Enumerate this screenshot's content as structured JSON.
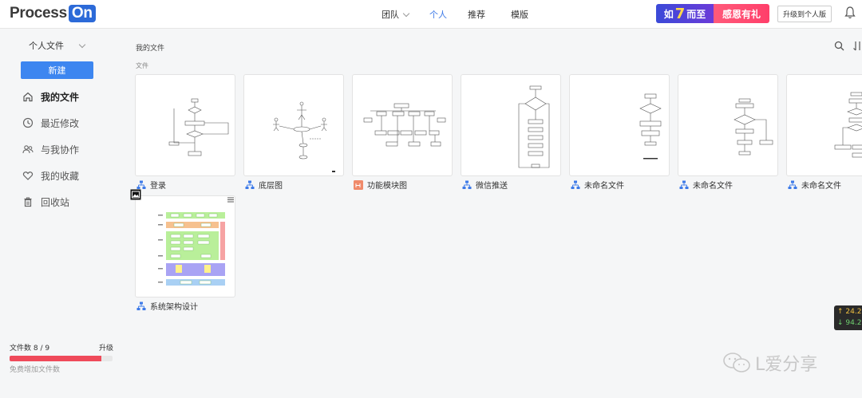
{
  "header": {
    "logo_text": "Process",
    "logo_badge": "On",
    "nav": [
      {
        "label": "团队",
        "has_dropdown": true
      },
      {
        "label": "个人",
        "active": true
      },
      {
        "label": "推荐"
      },
      {
        "label": "模版"
      }
    ],
    "promo": {
      "left_prefix": "如",
      "left_number": "7",
      "left_suffix": "而至",
      "right": "感恩有礼"
    },
    "upgrade_label": "升级到个人版"
  },
  "sidebar": {
    "selector_label": "个人文件",
    "new_button": "新建",
    "items": [
      {
        "label": "我的文件",
        "icon": "home-icon",
        "active": true
      },
      {
        "label": "最近修改",
        "icon": "clock-icon"
      },
      {
        "label": "与我协作",
        "icon": "users-icon"
      },
      {
        "label": "我的收藏",
        "icon": "heart-icon"
      },
      {
        "label": "回收站",
        "icon": "trash-icon"
      }
    ],
    "quota": {
      "label": "文件数 8 / 9",
      "upgrade": "升级",
      "used": 8,
      "total": 9,
      "hint": "免费增加文件数"
    }
  },
  "main": {
    "breadcrumb": "我的文件",
    "section_label": "文件",
    "files": [
      {
        "name": "登录",
        "icon": "flowchart-icon"
      },
      {
        "name": "底层图",
        "icon": "flowchart-icon"
      },
      {
        "name": "功能模块图",
        "icon": "mindmap-icon"
      },
      {
        "name": "微信推送",
        "icon": "flowchart-icon"
      },
      {
        "name": "未命名文件",
        "icon": "flowchart-icon"
      },
      {
        "name": "未命名文件",
        "icon": "flowchart-icon"
      },
      {
        "name": "未命名文件",
        "icon": "flowchart-icon"
      },
      {
        "name": "系统架构设计",
        "icon": "flowchart-icon"
      }
    ]
  },
  "overlay": {
    "stock_up": "↑ 24.2",
    "stock_down": "↓ 94.2",
    "watermark": "L爱分享"
  },
  "colors": {
    "accent": "#3d86f0",
    "brand": "#2c6ad8",
    "quota_fill": "#ef4a5a"
  }
}
